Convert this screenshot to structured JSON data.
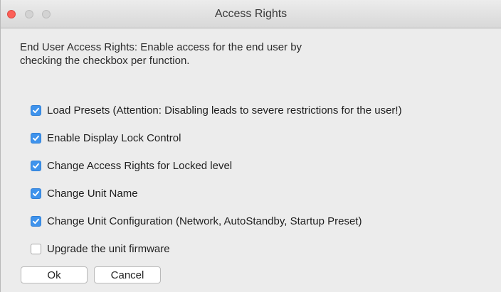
{
  "window": {
    "title": "Access Rights"
  },
  "description": "End User Access Rights: Enable access for the end user by checking the checkbox per function.",
  "options": [
    {
      "label": "Load Presets (Attention: Disabling leads to severe restrictions for the user!)",
      "checked": true
    },
    {
      "label": "Enable Display Lock Control",
      "checked": true
    },
    {
      "label": "Change Access Rights for Locked level",
      "checked": true
    },
    {
      "label": "Change Unit Name",
      "checked": true
    },
    {
      "label": "Change Unit Configuration (Network, AutoStandby, Startup Preset)",
      "checked": true
    },
    {
      "label": "Upgrade the unit firmware",
      "checked": false
    }
  ],
  "buttons": {
    "ok_label": "Ok",
    "cancel_label": "Cancel"
  },
  "colors": {
    "checkbox_accent": "#3f93ec",
    "close_button": "#fc5f57"
  }
}
